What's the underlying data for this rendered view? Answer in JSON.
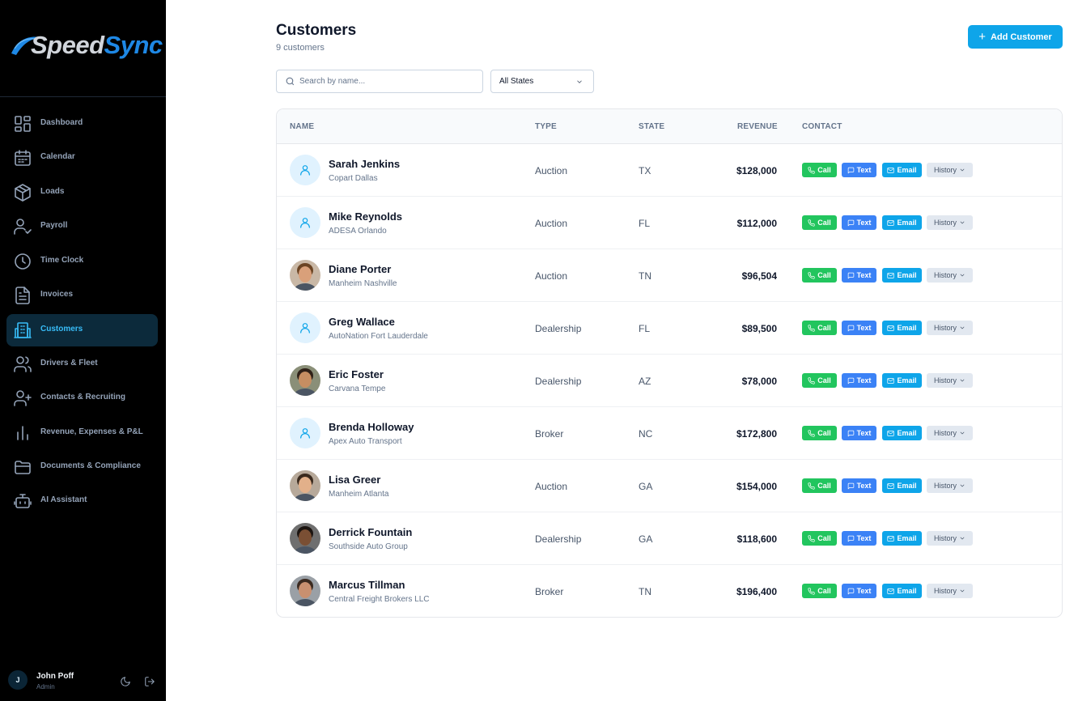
{
  "brand": {
    "speed": "Speed",
    "sync": "Sync"
  },
  "sidebar": {
    "items": [
      {
        "label": "Dashboard",
        "icon": "dashboard-icon"
      },
      {
        "label": "Calendar",
        "icon": "calendar-icon"
      },
      {
        "label": "Loads",
        "icon": "box-icon"
      },
      {
        "label": "Payroll",
        "icon": "user-check-icon"
      },
      {
        "label": "Time Clock",
        "icon": "clock-icon"
      },
      {
        "label": "Invoices",
        "icon": "file-text-icon"
      },
      {
        "label": "Customers",
        "icon": "building-icon",
        "active": true
      },
      {
        "label": "Drivers & Fleet",
        "icon": "users-icon"
      },
      {
        "label": "Contacts & Recruiting",
        "icon": "user-plus-icon"
      },
      {
        "label": "Revenue, Expenses & P&L",
        "icon": "bar-chart-icon"
      },
      {
        "label": "Documents & Compliance",
        "icon": "folder-icon"
      },
      {
        "label": "AI Assistant",
        "icon": "bot-icon"
      }
    ],
    "user": {
      "initial": "J",
      "name": "John Poff",
      "role": "Admin"
    }
  },
  "header": {
    "title": "Customers",
    "subtitle": "9 customers",
    "add_label": "Add Customer"
  },
  "filters": {
    "search_placeholder": "Search by name...",
    "state_selected": "All States"
  },
  "table": {
    "columns": [
      "NAME",
      "TYPE",
      "STATE",
      "REVENUE",
      "CONTACT"
    ],
    "actions": {
      "call": "Call",
      "text": "Text",
      "email": "Email",
      "history": "History"
    },
    "rows": [
      {
        "name": "Sarah Jenkins",
        "company": "Copart Dallas",
        "type": "Auction",
        "state": "TX",
        "revenue": "$128,000",
        "avatar": "generic"
      },
      {
        "name": "Mike Reynolds",
        "company": "ADESA Orlando",
        "type": "Auction",
        "state": "FL",
        "revenue": "$112,000",
        "avatar": "generic"
      },
      {
        "name": "Diane Porter",
        "company": "Manheim Nashville",
        "type": "Auction",
        "state": "TN",
        "revenue": "$96,504",
        "avatar": "photo"
      },
      {
        "name": "Greg Wallace",
        "company": "AutoNation Fort Lauderdale",
        "type": "Dealership",
        "state": "FL",
        "revenue": "$89,500",
        "avatar": "generic"
      },
      {
        "name": "Eric Foster",
        "company": "Carvana Tempe",
        "type": "Dealership",
        "state": "AZ",
        "revenue": "$78,000",
        "avatar": "photo"
      },
      {
        "name": "Brenda Holloway",
        "company": "Apex Auto Transport",
        "type": "Broker",
        "state": "NC",
        "revenue": "$172,800",
        "avatar": "generic"
      },
      {
        "name": "Lisa Greer",
        "company": "Manheim Atlanta",
        "type": "Auction",
        "state": "GA",
        "revenue": "$154,000",
        "avatar": "photo"
      },
      {
        "name": "Derrick Fountain",
        "company": "Southside Auto Group",
        "type": "Dealership",
        "state": "GA",
        "revenue": "$118,600",
        "avatar": "photo"
      },
      {
        "name": "Marcus Tillman",
        "company": "Central Freight Brokers LLC",
        "type": "Broker",
        "state": "TN",
        "revenue": "$196,400",
        "avatar": "photo"
      }
    ]
  }
}
